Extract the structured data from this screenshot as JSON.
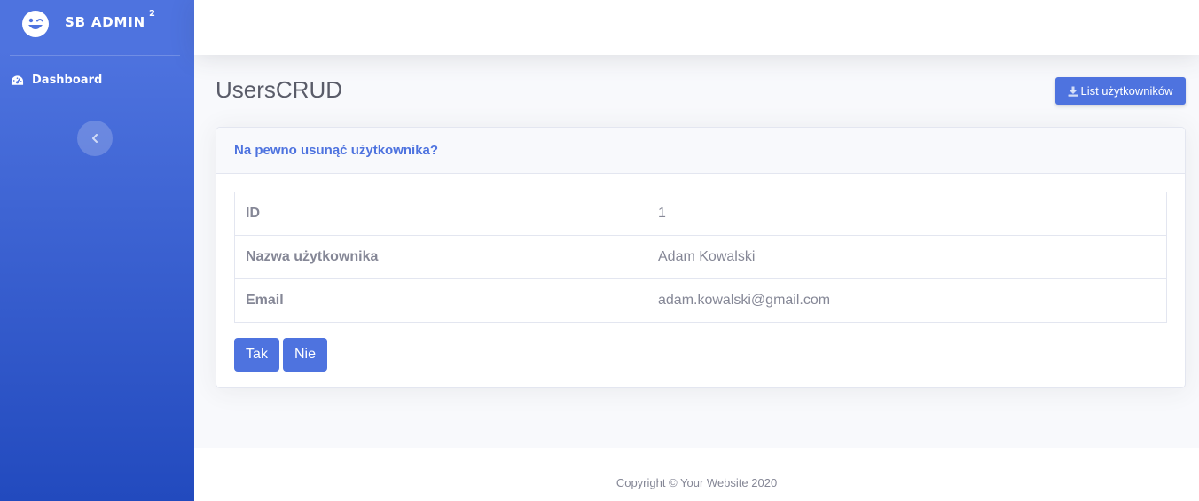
{
  "sidebar": {
    "brand": {
      "name": "SB ADMIN",
      "sup": "2",
      "icon": "laugh-wink-icon"
    },
    "items": [
      {
        "label": "Dashboard",
        "icon": "tachometer-icon"
      }
    ],
    "toggle_icon": "chevron-left-icon"
  },
  "main": {
    "title": "UsersCRUD",
    "list_button": {
      "label": "List użytkowników",
      "icon": "download-icon"
    },
    "card": {
      "title": "Na pewno usunąć użytkownika?",
      "rows": [
        {
          "label": "ID",
          "value": "1"
        },
        {
          "label": "Nazwa użytkownika",
          "value": "Adam Kowalski"
        },
        {
          "label": "Email",
          "value": "adam.kowalski@gmail.com"
        }
      ],
      "yes_label": "Tak",
      "no_label": "Nie"
    }
  },
  "footer": {
    "text": "Copyright © Your Website 2020"
  },
  "colors": {
    "primary": "#4e73df",
    "primary_dark": "#224abe",
    "text_muted": "#858796",
    "heading": "#5a5c69",
    "background": "#f8f9fc"
  }
}
